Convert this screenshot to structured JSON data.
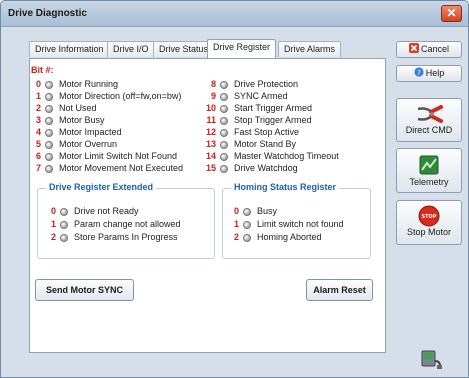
{
  "window": {
    "title": "Drive Diagnostic"
  },
  "tabs": [
    {
      "label": "Drive Information"
    },
    {
      "label": "Drive I/O"
    },
    {
      "label": "Drive Status"
    },
    {
      "label": "Drive Register",
      "active": true
    },
    {
      "label": "Drive Alarms"
    }
  ],
  "register": {
    "heading": "Bit #:",
    "bits_left": [
      {
        "num": "0",
        "label": "Motor Running"
      },
      {
        "num": "1",
        "label": "Motor Direction (off=fw,on=bw)"
      },
      {
        "num": "2",
        "label": "Not Used"
      },
      {
        "num": "3",
        "label": "Motor Busy"
      },
      {
        "num": "4",
        "label": "Motor Impacted"
      },
      {
        "num": "5",
        "label": "Motor Overrun"
      },
      {
        "num": "6",
        "label": "Motor Limit Switch Not Found"
      },
      {
        "num": "7",
        "label": "Motor Movement Not Executed"
      }
    ],
    "bits_right": [
      {
        "num": "8",
        "label": "Drive Protection"
      },
      {
        "num": "9",
        "label": "SYNC Armed"
      },
      {
        "num": "10",
        "label": "Start Trigger Armed"
      },
      {
        "num": "11",
        "label": "Stop Trigger Armed"
      },
      {
        "num": "12",
        "label": "Fast Stop Active"
      },
      {
        "num": "13",
        "label": "Motor Stand By"
      },
      {
        "num": "14",
        "label": "Master Watchdog Timeout"
      },
      {
        "num": "15",
        "label": "Drive Watchdog"
      }
    ]
  },
  "extended": {
    "title": "Drive Register Extended",
    "bits": [
      {
        "num": "0",
        "label": "Drive not Ready"
      },
      {
        "num": "1",
        "label": "Param change not allowed"
      },
      {
        "num": "2",
        "label": "Store Params In Progress"
      }
    ]
  },
  "homing": {
    "title": "Homing Status Register",
    "bits": [
      {
        "num": "0",
        "label": "Busy"
      },
      {
        "num": "1",
        "label": "Limit switch not found"
      },
      {
        "num": "2",
        "label": "Homing Aborted"
      }
    ]
  },
  "buttons": {
    "send_sync": "Send Motor SYNC",
    "alarm_reset": "Alarm Reset"
  },
  "side": {
    "cancel": "Cancel",
    "help": "Help",
    "direct_cmd": "Direct CMD",
    "telemetry": "Telemetry",
    "stop_motor": "Stop Motor",
    "stop_sign_text": "STOP"
  },
  "colors": {
    "bit_number": "#c62020",
    "group_title": "#1d5fb5",
    "stop_red": "#d92a1c"
  }
}
